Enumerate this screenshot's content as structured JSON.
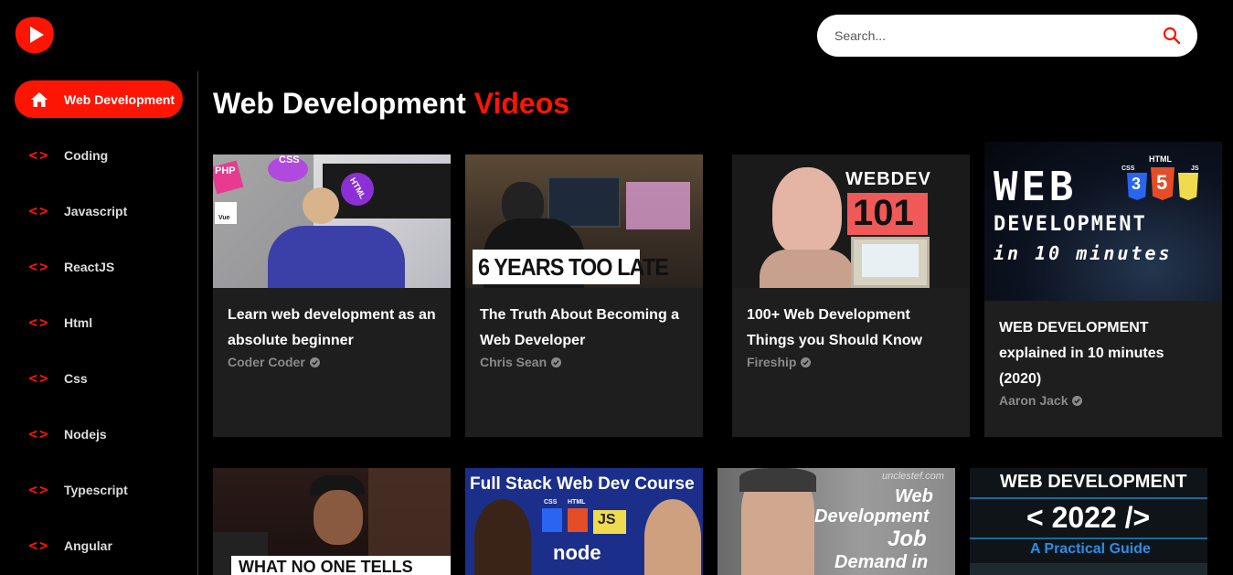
{
  "app": {
    "logo_icon": "play-logo-icon",
    "accent_color": "#fc1503"
  },
  "search": {
    "placeholder": "Search...",
    "icon": "search-icon"
  },
  "sidebar": {
    "items": [
      {
        "label": "Web Development",
        "icon": "home-icon",
        "active": true
      },
      {
        "label": "Coding",
        "icon": "code-icon"
      },
      {
        "label": "Javascript",
        "icon": "code-icon"
      },
      {
        "label": "ReactJS",
        "icon": "code-icon"
      },
      {
        "label": "Html",
        "icon": "code-icon"
      },
      {
        "label": "Css",
        "icon": "code-icon"
      },
      {
        "label": "Nodejs",
        "icon": "code-icon"
      },
      {
        "label": "Typescript",
        "icon": "code-icon"
      },
      {
        "label": "Angular",
        "icon": "code-icon"
      }
    ]
  },
  "main": {
    "title_main": "Web Development",
    "title_accent": "Videos"
  },
  "videos": [
    {
      "title": "Learn web development as an absolute beginner",
      "channel": "Coder Coder",
      "verified": true,
      "thumb_text": [
        "PHP",
        "CSS",
        "HTML",
        "Vue"
      ]
    },
    {
      "title": "The Truth About Becoming a Web Developer",
      "channel": "Chris Sean",
      "verified": true,
      "thumb_text": [
        "6 YEARS TOO LATE"
      ]
    },
    {
      "title": "100+ Web Development Things you Should Know",
      "channel": "Fireship",
      "verified": true,
      "thumb_text": [
        "WEBDEV",
        "101"
      ]
    },
    {
      "title": "WEB DEVELOPMENT explained in 10 minutes (2020)",
      "channel": "Aaron Jack",
      "verified": true,
      "thumb_text": [
        "WEB",
        "DEVELOPMENT",
        "in 10 minutes",
        "HTML",
        "CSS",
        "JS",
        "3",
        "5"
      ]
    },
    {
      "title": "",
      "channel": "",
      "thumb_text": [
        "WHAT NO ONE TELLS YOU"
      ]
    },
    {
      "title": "",
      "channel": "",
      "thumb_text": [
        "Full Stack Web Dev Course",
        "CSS",
        "HTML",
        "JS",
        "node"
      ]
    },
    {
      "title": "",
      "channel": "",
      "thumb_text": [
        "unclestef.com",
        "Web",
        "Development",
        "Job",
        "Demand in"
      ]
    },
    {
      "title": "",
      "channel": "",
      "thumb_text": [
        "WEB DEVELOPMENT",
        "< 2022 />",
        "A Practical Guide"
      ]
    }
  ]
}
